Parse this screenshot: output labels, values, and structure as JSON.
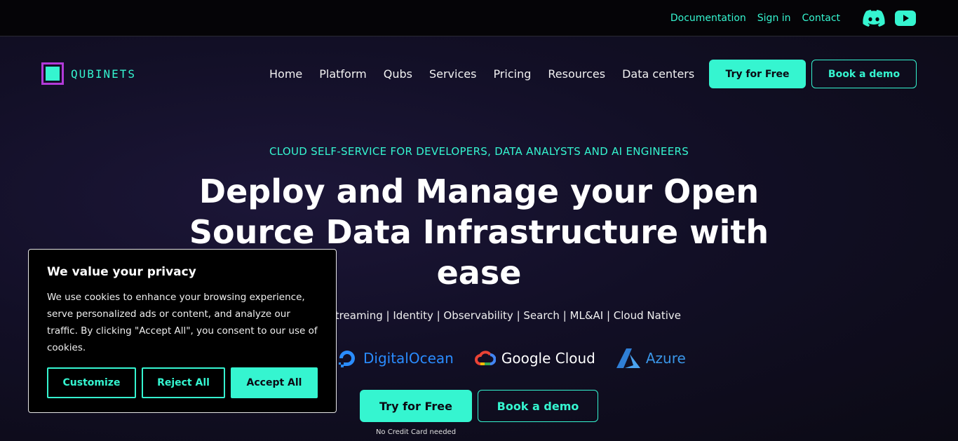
{
  "topbar": {
    "links": [
      "Documentation",
      "Sign in",
      "Contact"
    ],
    "social": [
      "discord-icon",
      "youtube-icon"
    ]
  },
  "nav": {
    "logo_text": "QUBINETS",
    "links": [
      "Home",
      "Platform",
      "Qubs",
      "Services",
      "Pricing",
      "Resources",
      "Data centers"
    ],
    "try_label": "Try for Free",
    "demo_label": "Book a demo"
  },
  "hero": {
    "eyebrow": "CLOUD SELF-SERVICE FOR DEVELOPERS, DATA ANALYSTS AND AI ENGINEERS",
    "headline": "Deploy and Manage your Open Source Data Infrastructure with ease",
    "tagline": "Storage | Streaming | Identity | Observability | Search | ML&AI | Cloud Native",
    "clouds": [
      "DigitalOcean",
      "Google Cloud",
      "Azure"
    ],
    "try_label": "Try for Free",
    "demo_label": "Book a demo",
    "note": "No Credit Card needed"
  },
  "cookie": {
    "title": "We value your privacy",
    "text": "We use cookies to enhance your browsing experience, serve personalized ads or content, and analyze our traffic. By clicking \"Accept All\", you consent to our use of cookies.",
    "customize": "Customize",
    "reject": "Reject All",
    "accept": "Accept All"
  },
  "colors": {
    "accent": "#35f5d0",
    "logo_purple": "#b23ad9",
    "background": "#0b0a14"
  }
}
